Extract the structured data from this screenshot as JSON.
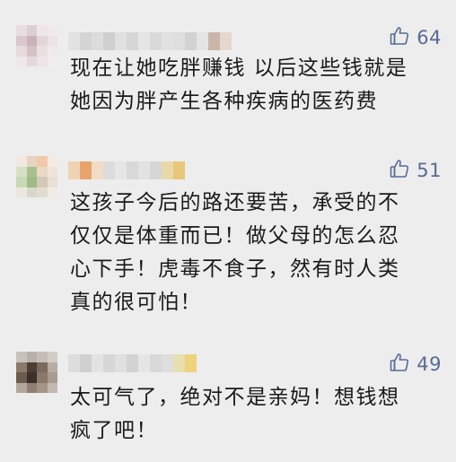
{
  "comments": [
    {
      "likes": "64",
      "text": "现在让她吃胖赚钱 以后这些钱就是\n她因为胖产生各种疾病的医药费"
    },
    {
      "likes": "51",
      "text": "这孩子今后的路还要苦，承受的不\n仅仅是体重而已！做父母的怎么忍\n心下手！虎毒不食子，然有时人类\n真的很可怕！"
    },
    {
      "likes": "49",
      "text": "太可气了，绝对不是亲妈！想钱想\n疯了吧！"
    }
  ],
  "colors": {
    "background": "#ededed",
    "like_accent": "#576b95",
    "text": "#1a1a1a"
  },
  "icons": {
    "like": "thumbs-up-icon"
  }
}
